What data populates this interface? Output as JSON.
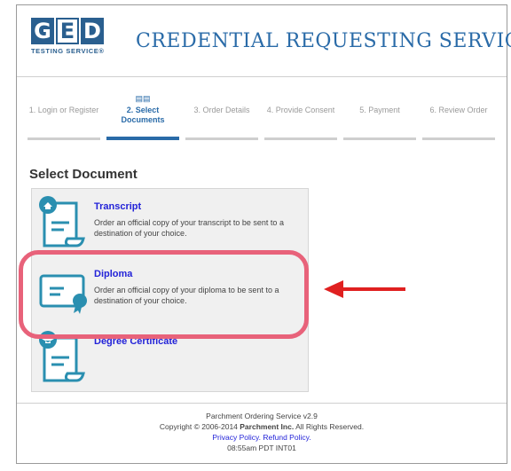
{
  "header": {
    "logo_letters": [
      "G",
      "E",
      "D"
    ],
    "logo_sub": "TESTING SERVICE®",
    "title": "CREDENTIAL REQUESTING SERVICE"
  },
  "steps": [
    {
      "label": "1. Login or Register"
    },
    {
      "label": "2. Select Documents",
      "active": true
    },
    {
      "label": "3. Order Details"
    },
    {
      "label": "4. Provide Consent"
    },
    {
      "label": "5. Payment"
    },
    {
      "label": "6. Review Order"
    }
  ],
  "section_title": "Select Document",
  "documents": [
    {
      "name": "Transcript",
      "description": "Order an official copy of your transcript to be sent to a destination of your choice."
    },
    {
      "name": "Diploma",
      "description": "Order an official copy of your diploma to be sent to a destination of your choice."
    },
    {
      "name": "Degree Certificate",
      "description": ""
    }
  ],
  "footer": {
    "service": "Parchment Ordering Service v2.9",
    "copyright_prefix": "Copyright © 2006-2014 ",
    "copyright_company": "Parchment Inc.",
    "copyright_suffix": " All Rights Reserved.",
    "privacy": "Privacy Policy.",
    "refund": "Refund Policy.",
    "time": "08:55am PDT INT01"
  },
  "colors": {
    "accent": "#2a6ba8",
    "highlight": "#e8627a",
    "arrow": "#e02020",
    "link": "#2323d8"
  }
}
